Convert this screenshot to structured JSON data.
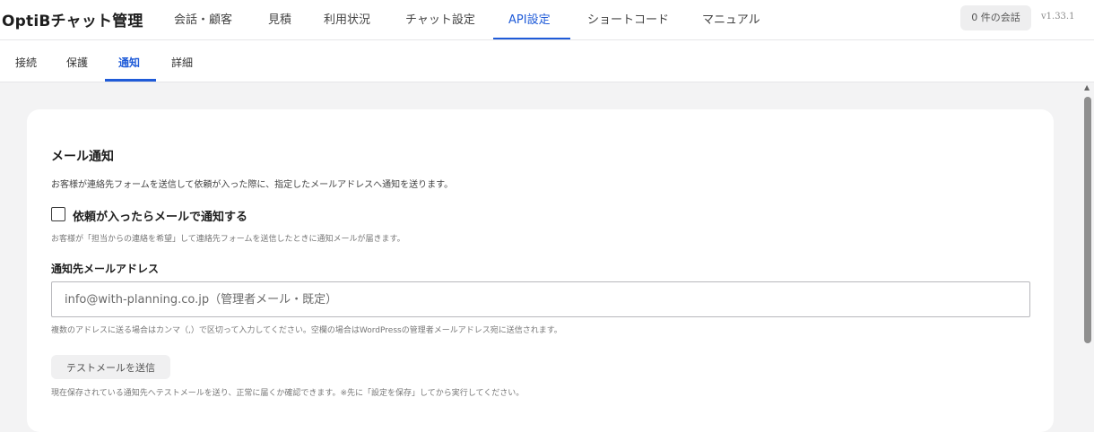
{
  "header": {
    "brand": "OptiBチャット管理",
    "nav": [
      {
        "label": "会話・顧客"
      },
      {
        "label": "見積"
      },
      {
        "label": "利用状況"
      },
      {
        "label": "チャット設定"
      },
      {
        "label": "API設定",
        "active": true
      },
      {
        "label": "ショートコード"
      },
      {
        "label": "マニュアル"
      }
    ],
    "conversation_badge": "0 件の会話",
    "version": "v1.33.1"
  },
  "subtabs": [
    {
      "label": "接続"
    },
    {
      "label": "保護"
    },
    {
      "label": "通知",
      "active": true
    },
    {
      "label": "詳細"
    }
  ],
  "section": {
    "title": "メール通知",
    "description": "お客様が連絡先フォームを送信して依頼が入った際に、指定したメールアドレスへ通知を送ります。",
    "checkbox_label": "依頼が入ったらメールで通知する",
    "checkbox_checked": false,
    "checkbox_help": "お客様が「担当からの連絡を希望」して連絡先フォームを送信したときに通知メールが届きます。",
    "email_label": "通知先メールアドレス",
    "email_value": "",
    "email_placeholder": "info@with-planning.co.jp（管理者メール・既定）",
    "email_help": "複数のアドレスに送る場合はカンマ（,）で区切って入力してください。空欄の場合はWordPressの管理者メールアドレス宛に送信されます。",
    "test_button": "テストメールを送信",
    "test_help": "現在保存されている通知先へテストメールを送り、正常に届くか確認できます。※先に「設定を保存」してから実行してください。"
  },
  "colors": {
    "accent": "#1f5bd8",
    "background": "#f3f3f4",
    "card": "#ffffff"
  }
}
